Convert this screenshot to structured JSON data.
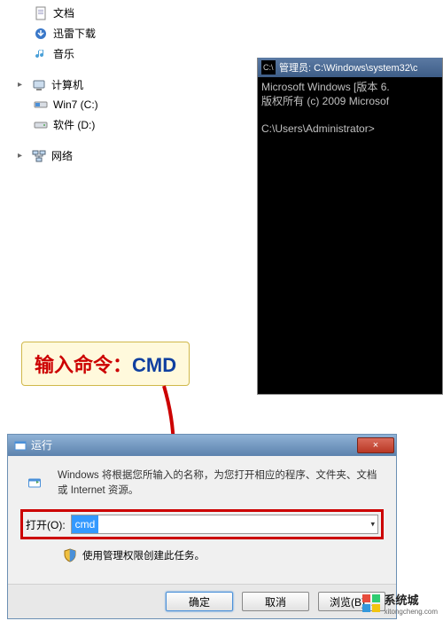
{
  "explorer": {
    "items": [
      {
        "label": "文档",
        "type": "doc"
      },
      {
        "label": "迅雷下载",
        "type": "folder"
      },
      {
        "label": "音乐",
        "type": "music"
      }
    ],
    "computer_label": "计算机",
    "drives": [
      {
        "label": "Win7 (C:)",
        "type": "drive"
      },
      {
        "label": "软件 (D:)",
        "type": "drive"
      }
    ],
    "network_label": "网络"
  },
  "cmd": {
    "title": "管理员: C:\\Windows\\system32\\c",
    "line1": "Microsoft Windows [版本 6.",
    "line2": "版权所有 (c) 2009 Microsof",
    "prompt": "C:\\Users\\Administrator>"
  },
  "callout": {
    "part1": "输入命令：",
    "part2": "CMD"
  },
  "run": {
    "title": "运行",
    "close": "×",
    "description": "Windows 将根据您所输入的名称，为您打开相应的程序、文件夹、文档或 Internet 资源。",
    "open_label": "打开(O):",
    "input_value": "cmd",
    "admin_text": "使用管理权限创建此任务。",
    "ok": "确定",
    "cancel": "取消",
    "browse": "浏览(B)..."
  },
  "watermark": {
    "text": "系统城",
    "sub": "xitongcheng.com"
  }
}
